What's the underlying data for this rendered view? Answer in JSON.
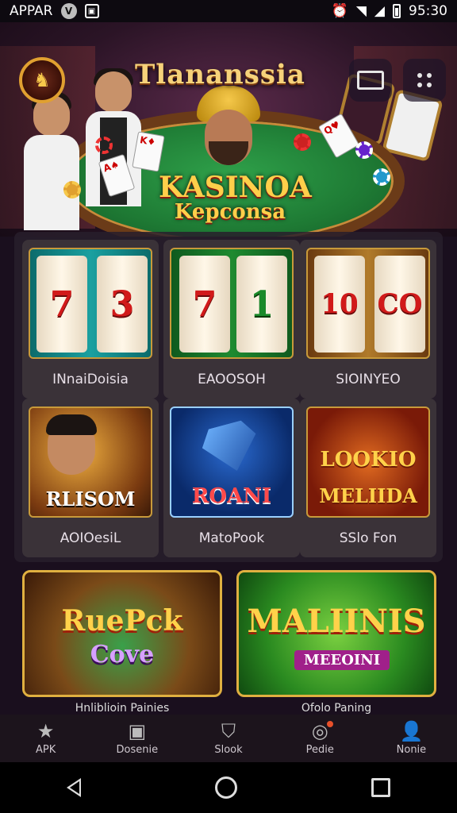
{
  "status_bar": {
    "app_label": "APPAR",
    "time": "95:30"
  },
  "header": {
    "title": "Tlananssia",
    "hero_caption_line1": "KASINOA",
    "hero_caption_line2": "Kepconsa"
  },
  "games": [
    {
      "name": "INnaiDoisia",
      "reels": [
        "7",
        "3"
      ]
    },
    {
      "name": "EAOOSOH",
      "reels": [
        "7",
        "1"
      ]
    },
    {
      "name": "SIOINYEO",
      "reels": [
        "10",
        "CO"
      ]
    },
    {
      "name": "AOIOesiL",
      "art_label": "RLISOM"
    },
    {
      "name": "MatoPook",
      "art_label": "ROANI"
    },
    {
      "name": "SSlo Fon",
      "art_label_1": "LOOKIO",
      "art_label_2": "MELIIDA"
    }
  ],
  "featured": [
    {
      "title_1": "RuePck",
      "title_2": "Cove",
      "caption": "Hnliblioin Painies"
    },
    {
      "title_1": "MALIINIS",
      "title_2": "MEEOINI",
      "caption": "Ofolo Paning"
    }
  ],
  "bottom_nav": [
    {
      "label": "APK",
      "icon": "star-icon"
    },
    {
      "label": "Dosenie",
      "icon": "monitor-icon"
    },
    {
      "label": "Slook",
      "icon": "shield-icon"
    },
    {
      "label": "Pedie",
      "icon": "badge-icon"
    },
    {
      "label": "Nonie",
      "icon": "user-icon"
    }
  ],
  "colors": {
    "accent_gold": "#e0b040",
    "table_green": "#1e7a34",
    "background": "#1a0f1e"
  }
}
